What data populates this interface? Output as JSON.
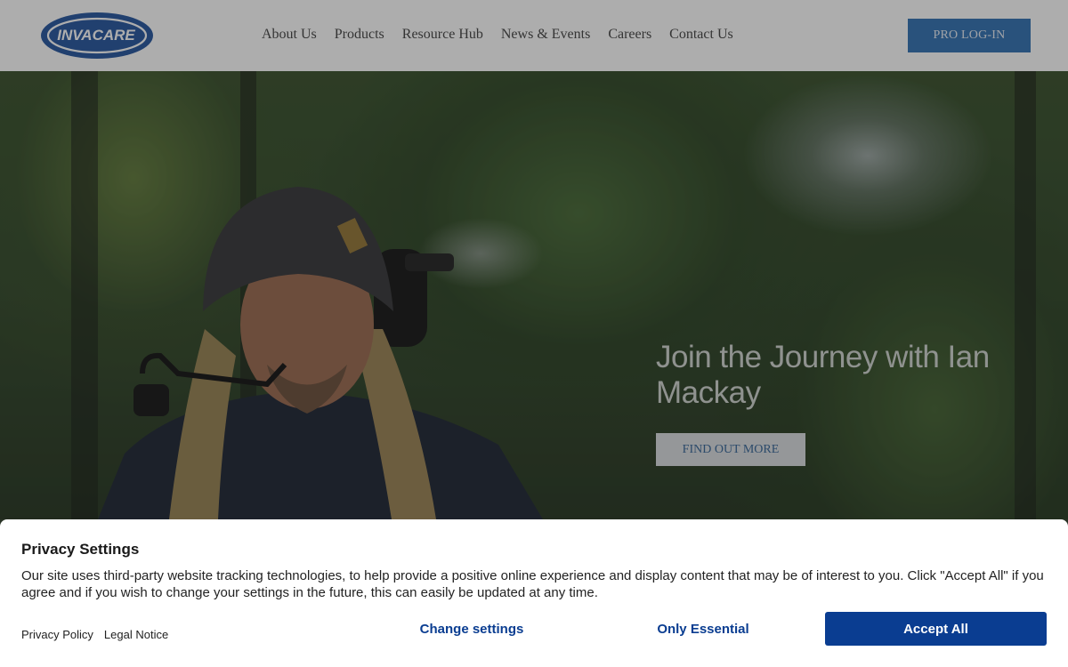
{
  "header": {
    "logo_text": "INVACARE",
    "nav": [
      "About Us",
      "Products",
      "Resource Hub",
      "News & Events",
      "Careers",
      "Contact Us"
    ],
    "pro_login": "PRO LOG-IN",
    "colors": {
      "brand_blue": "#2b6cb0",
      "logo_blue": "#1d4f9c"
    }
  },
  "hero": {
    "title": "Join the Journey with Ian Mackay",
    "cta": "FIND OUT MORE"
  },
  "privacy": {
    "title": "Privacy Settings",
    "text": "Our site uses third-party website tracking technologies, to help provide a positive online experience and display content that may be of interest to you. Click \"Accept All\" if you agree and if you wish to change your settings in the future, this can easily be updated at any time.",
    "links": [
      "Privacy Policy",
      "Legal Notice"
    ],
    "change_settings": "Change settings",
    "only_essential": "Only Essential",
    "accept_all": "Accept All",
    "colors": {
      "accent": "#0a3d91"
    }
  }
}
